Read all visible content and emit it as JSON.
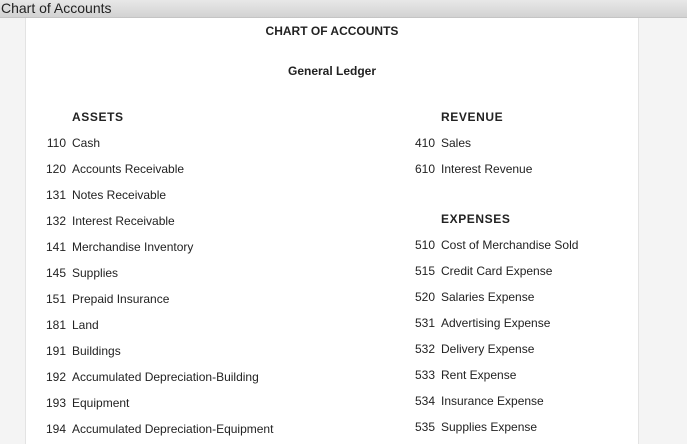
{
  "window": {
    "title": "Chart of Accounts"
  },
  "header": {
    "title": "CHART OF ACCOUNTS",
    "subtitle": "General Ledger"
  },
  "assets": {
    "title": "ASSETS",
    "items": [
      {
        "number": "110",
        "name": "Cash"
      },
      {
        "number": "120",
        "name": "Accounts Receivable"
      },
      {
        "number": "131",
        "name": "Notes Receivable"
      },
      {
        "number": "132",
        "name": "Interest Receivable"
      },
      {
        "number": "141",
        "name": "Merchandise Inventory"
      },
      {
        "number": "145",
        "name": "Supplies"
      },
      {
        "number": "151",
        "name": "Prepaid Insurance"
      },
      {
        "number": "181",
        "name": "Land"
      },
      {
        "number": "191",
        "name": "Buildings"
      },
      {
        "number": "192",
        "name": "Accumulated Depreciation-Building"
      },
      {
        "number": "193",
        "name": "Equipment"
      },
      {
        "number": "194",
        "name": "Accumulated Depreciation-Equipment"
      }
    ]
  },
  "revenue": {
    "title": "REVENUE",
    "items": [
      {
        "number": "410",
        "name": "Sales"
      },
      {
        "number": "610",
        "name": "Interest Revenue"
      }
    ]
  },
  "expenses": {
    "title": "EXPENSES",
    "items": [
      {
        "number": "510",
        "name": "Cost of Merchandise Sold"
      },
      {
        "number": "515",
        "name": "Credit Card Expense"
      },
      {
        "number": "520",
        "name": "Salaries Expense"
      },
      {
        "number": "531",
        "name": "Advertising Expense"
      },
      {
        "number": "532",
        "name": "Delivery Expense"
      },
      {
        "number": "533",
        "name": "Rent Expense"
      },
      {
        "number": "534",
        "name": "Insurance Expense"
      },
      {
        "number": "535",
        "name": "Supplies Expense"
      }
    ]
  }
}
